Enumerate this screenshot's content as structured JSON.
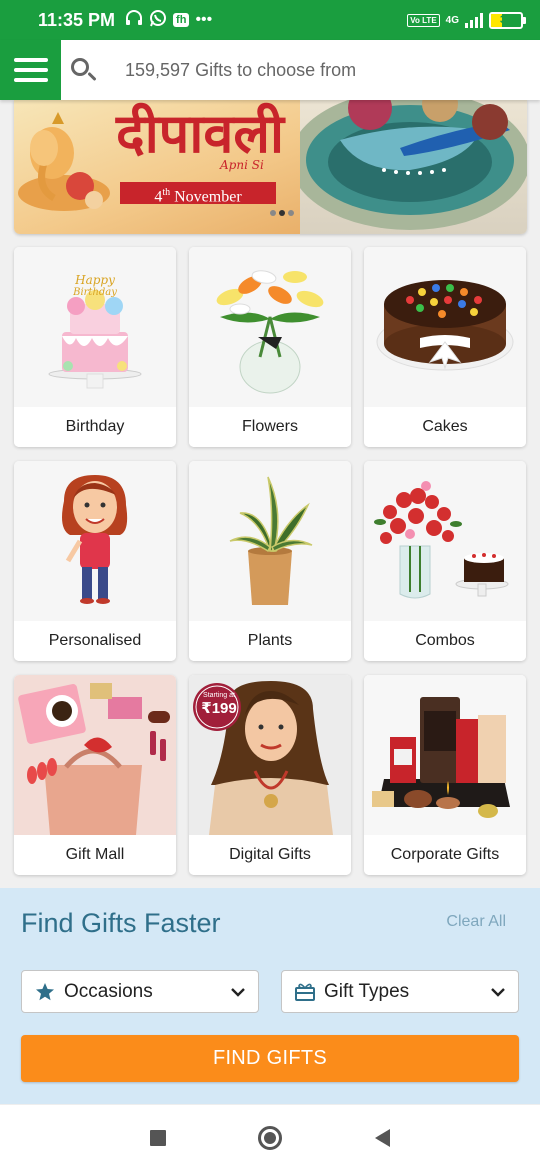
{
  "status_bar": {
    "time": "11:35 PM",
    "network_type": "4G",
    "volte": "Vo LTE",
    "battery_percent": "37",
    "battery_level": 0.37,
    "app_badge": "fh"
  },
  "header": {
    "search_placeholder": "159,597 Gifts to choose from"
  },
  "banner": {
    "title": "दीपावली",
    "subtitle": "Apni Si",
    "date_day": "4",
    "date_suffix": "th",
    "date_month": "November",
    "slide_count": 3,
    "active_slide": 2
  },
  "categories": [
    {
      "label": "Birthday",
      "icon": "birthday-cake-image"
    },
    {
      "label": "Flowers",
      "icon": "flower-bouquet-image"
    },
    {
      "label": "Cakes",
      "icon": "kitkat-cake-image"
    },
    {
      "label": "Personalised",
      "icon": "caricature-image"
    },
    {
      "label": "Plants",
      "icon": "snake-plant-image"
    },
    {
      "label": "Combos",
      "icon": "roses-cake-combo-image"
    },
    {
      "label": "Gift Mall",
      "icon": "gift-mall-image"
    },
    {
      "label": "Digital Gifts",
      "icon": "digital-gifts-image"
    },
    {
      "label": "Corporate Gifts",
      "icon": "corporate-hamper-image"
    }
  ],
  "digital_badge": {
    "line1": "Starting at",
    "price": "₹199"
  },
  "finder": {
    "title": "Find Gifts Faster",
    "clear_label": "Clear All",
    "occasions_label": "Occasions",
    "gift_types_label": "Gift Types",
    "button_label": "FIND GIFTS"
  },
  "colors": {
    "brand_green": "#1a9e3f",
    "accent_orange": "#fb8c1a",
    "finder_bg": "#d4e8f6",
    "finder_title": "#2f6f8a"
  }
}
